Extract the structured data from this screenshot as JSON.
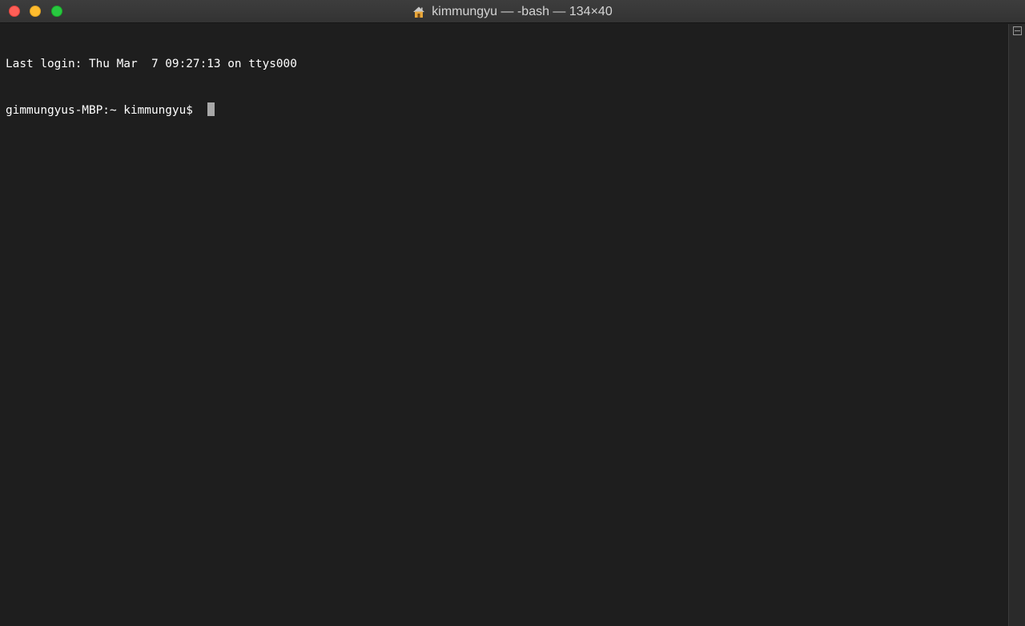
{
  "window": {
    "title": "kimmungyu — -bash — 134×40",
    "title_icon": "home-folder-icon"
  },
  "terminal": {
    "lines": [
      "Last login: Thu Mar  7 09:27:13 on ttys000",
      "gimmungyus-MBP:~ kimmungyu$ "
    ]
  },
  "colors": {
    "background": "#1e1e1e",
    "text": "#ffffff",
    "cursor": "#a8a8a8"
  }
}
